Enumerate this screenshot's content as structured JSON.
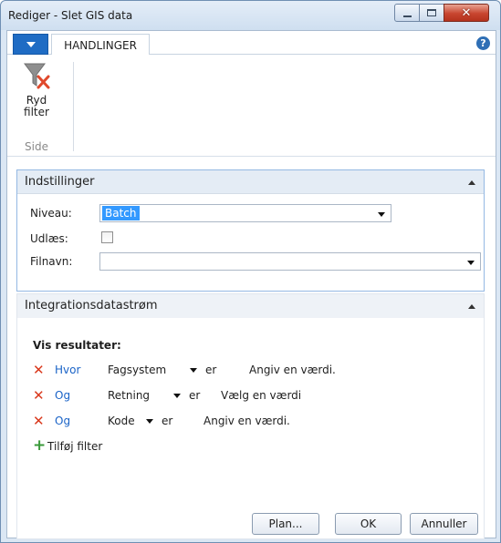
{
  "window": {
    "title": "Rediger - Slet GIS data",
    "close_glyph": "✕"
  },
  "ribbon": {
    "app_button_icon": "caret-down-icon",
    "tab_label": "HANDLINGER",
    "help_glyph": "?",
    "action_line1": "Ryd",
    "action_line2": "filter",
    "action_icon": "clear-filter-icon",
    "group_label": "Side"
  },
  "settings": {
    "title": "Indstillinger",
    "niveau_label": "Niveau:",
    "niveau_value": "Batch",
    "udlaes_label": "Udlæs:",
    "udlaes_checked": false,
    "filnavn_label": "Filnavn:",
    "filnavn_value": ""
  },
  "integration": {
    "title": "Integrationsdatastrøm",
    "results_label": "Vis resultater:",
    "filters": [
      {
        "op": "Hvor",
        "field": "Fagsystem",
        "er": "er",
        "value": "Angiv en værdi."
      },
      {
        "op": "Og",
        "field": "Retning",
        "er": "er",
        "value": "Vælg en værdi"
      },
      {
        "op": "Og",
        "field": "Kode",
        "er": "er",
        "value": "Angiv en værdi."
      }
    ],
    "add_filter_label": "Tilføj filter"
  },
  "buttons": {
    "plan": "Plan...",
    "ok": "OK",
    "cancel": "Annuller"
  },
  "colors": {
    "accent": "#1f6cc4",
    "delete_red": "#d9391d",
    "add_green": "#3a9a3a",
    "link_blue": "#1a63c7"
  }
}
